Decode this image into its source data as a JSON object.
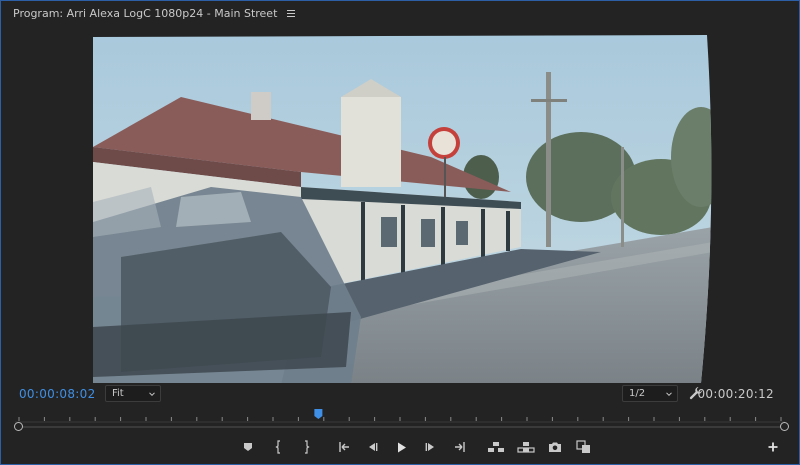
{
  "panel": {
    "title": "Program: Arri Alexa LogC 1080p24 - Main Street",
    "menu_icon": "hamburger-icon"
  },
  "timecode": {
    "current": "00:00:08:02",
    "duration": "00:00:20:12"
  },
  "zoom": {
    "selected": "Fit"
  },
  "resolution": {
    "selected": "1/2"
  },
  "playhead": {
    "position_fraction": 0.394
  },
  "transport": {
    "buttons": [
      "add-marker-icon",
      "mark-in-icon",
      "mark-out-icon",
      "go-to-in-icon",
      "step-back-icon",
      "play-icon",
      "step-forward-icon",
      "go-to-out-icon",
      "insert-icon",
      "overwrite-icon",
      "export-frame-icon",
      "comparison-view-icon",
      "button-editor-icon"
    ]
  },
  "colors": {
    "accent_blue": "#3f8fe6",
    "panel_bg": "#232323",
    "text": "#c9c9c9"
  }
}
